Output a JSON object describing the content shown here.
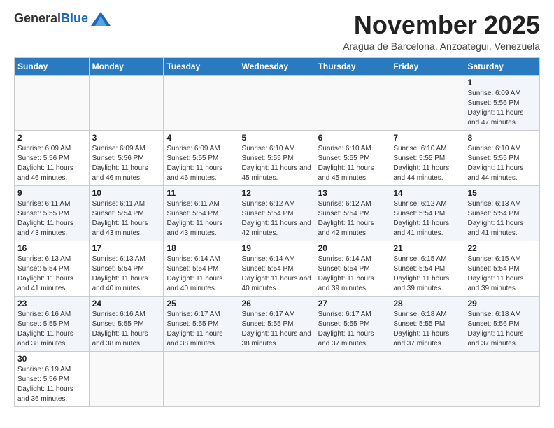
{
  "logo": {
    "general": "General",
    "blue": "Blue"
  },
  "title": "November 2025",
  "subtitle": "Aragua de Barcelona, Anzoategui, Venezuela",
  "days_of_week": [
    "Sunday",
    "Monday",
    "Tuesday",
    "Wednesday",
    "Thursday",
    "Friday",
    "Saturday"
  ],
  "weeks": [
    [
      {
        "day": "",
        "info": ""
      },
      {
        "day": "",
        "info": ""
      },
      {
        "day": "",
        "info": ""
      },
      {
        "day": "",
        "info": ""
      },
      {
        "day": "",
        "info": ""
      },
      {
        "day": "",
        "info": ""
      },
      {
        "day": "1",
        "info": "Sunrise: 6:09 AM\nSunset: 5:56 PM\nDaylight: 11 hours and 47 minutes."
      }
    ],
    [
      {
        "day": "2",
        "info": "Sunrise: 6:09 AM\nSunset: 5:56 PM\nDaylight: 11 hours and 46 minutes."
      },
      {
        "day": "3",
        "info": "Sunrise: 6:09 AM\nSunset: 5:56 PM\nDaylight: 11 hours and 46 minutes."
      },
      {
        "day": "4",
        "info": "Sunrise: 6:09 AM\nSunset: 5:55 PM\nDaylight: 11 hours and 46 minutes."
      },
      {
        "day": "5",
        "info": "Sunrise: 6:10 AM\nSunset: 5:55 PM\nDaylight: 11 hours and 45 minutes."
      },
      {
        "day": "6",
        "info": "Sunrise: 6:10 AM\nSunset: 5:55 PM\nDaylight: 11 hours and 45 minutes."
      },
      {
        "day": "7",
        "info": "Sunrise: 6:10 AM\nSunset: 5:55 PM\nDaylight: 11 hours and 44 minutes."
      },
      {
        "day": "8",
        "info": "Sunrise: 6:10 AM\nSunset: 5:55 PM\nDaylight: 11 hours and 44 minutes."
      }
    ],
    [
      {
        "day": "9",
        "info": "Sunrise: 6:11 AM\nSunset: 5:55 PM\nDaylight: 11 hours and 43 minutes."
      },
      {
        "day": "10",
        "info": "Sunrise: 6:11 AM\nSunset: 5:54 PM\nDaylight: 11 hours and 43 minutes."
      },
      {
        "day": "11",
        "info": "Sunrise: 6:11 AM\nSunset: 5:54 PM\nDaylight: 11 hours and 43 minutes."
      },
      {
        "day": "12",
        "info": "Sunrise: 6:12 AM\nSunset: 5:54 PM\nDaylight: 11 hours and 42 minutes."
      },
      {
        "day": "13",
        "info": "Sunrise: 6:12 AM\nSunset: 5:54 PM\nDaylight: 11 hours and 42 minutes."
      },
      {
        "day": "14",
        "info": "Sunrise: 6:12 AM\nSunset: 5:54 PM\nDaylight: 11 hours and 41 minutes."
      },
      {
        "day": "15",
        "info": "Sunrise: 6:13 AM\nSunset: 5:54 PM\nDaylight: 11 hours and 41 minutes."
      }
    ],
    [
      {
        "day": "16",
        "info": "Sunrise: 6:13 AM\nSunset: 5:54 PM\nDaylight: 11 hours and 41 minutes."
      },
      {
        "day": "17",
        "info": "Sunrise: 6:13 AM\nSunset: 5:54 PM\nDaylight: 11 hours and 40 minutes."
      },
      {
        "day": "18",
        "info": "Sunrise: 6:14 AM\nSunset: 5:54 PM\nDaylight: 11 hours and 40 minutes."
      },
      {
        "day": "19",
        "info": "Sunrise: 6:14 AM\nSunset: 5:54 PM\nDaylight: 11 hours and 40 minutes."
      },
      {
        "day": "20",
        "info": "Sunrise: 6:14 AM\nSunset: 5:54 PM\nDaylight: 11 hours and 39 minutes."
      },
      {
        "day": "21",
        "info": "Sunrise: 6:15 AM\nSunset: 5:54 PM\nDaylight: 11 hours and 39 minutes."
      },
      {
        "day": "22",
        "info": "Sunrise: 6:15 AM\nSunset: 5:54 PM\nDaylight: 11 hours and 39 minutes."
      }
    ],
    [
      {
        "day": "23",
        "info": "Sunrise: 6:16 AM\nSunset: 5:55 PM\nDaylight: 11 hours and 38 minutes."
      },
      {
        "day": "24",
        "info": "Sunrise: 6:16 AM\nSunset: 5:55 PM\nDaylight: 11 hours and 38 minutes."
      },
      {
        "day": "25",
        "info": "Sunrise: 6:17 AM\nSunset: 5:55 PM\nDaylight: 11 hours and 38 minutes."
      },
      {
        "day": "26",
        "info": "Sunrise: 6:17 AM\nSunset: 5:55 PM\nDaylight: 11 hours and 38 minutes."
      },
      {
        "day": "27",
        "info": "Sunrise: 6:17 AM\nSunset: 5:55 PM\nDaylight: 11 hours and 37 minutes."
      },
      {
        "day": "28",
        "info": "Sunrise: 6:18 AM\nSunset: 5:55 PM\nDaylight: 11 hours and 37 minutes."
      },
      {
        "day": "29",
        "info": "Sunrise: 6:18 AM\nSunset: 5:56 PM\nDaylight: 11 hours and 37 minutes."
      }
    ],
    [
      {
        "day": "30",
        "info": "Sunrise: 6:19 AM\nSunset: 5:56 PM\nDaylight: 11 hours and 36 minutes."
      },
      {
        "day": "",
        "info": ""
      },
      {
        "day": "",
        "info": ""
      },
      {
        "day": "",
        "info": ""
      },
      {
        "day": "",
        "info": ""
      },
      {
        "day": "",
        "info": ""
      },
      {
        "day": "",
        "info": ""
      }
    ]
  ]
}
